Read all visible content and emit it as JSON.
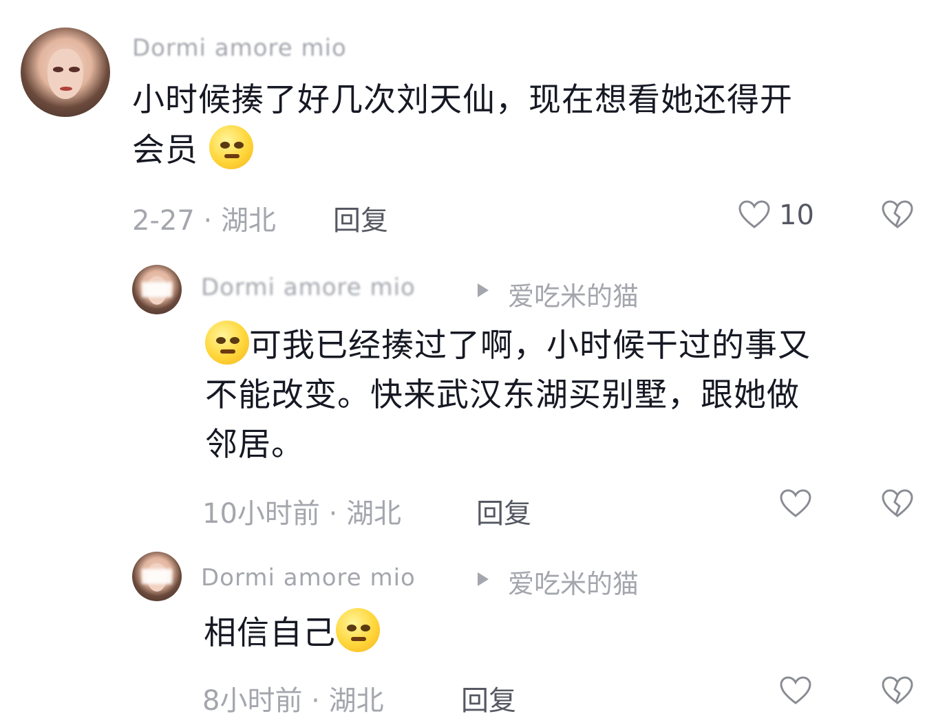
{
  "comments": [
    {
      "username": "Dormi amore mio",
      "text_line1": "小时候揍了好几次刘天仙，现在想看她还得开",
      "text_line2": "会员",
      "emoji": "shy-emoji",
      "date": "2-27",
      "location": "湖北",
      "reply_label": "回复",
      "like_count": "10"
    },
    {
      "username": "Dormi amore mio",
      "reply_to": "爱吃米的猫",
      "text_line1": "可我已经揍过了啊，小时候干过的事又",
      "text_line2": "不能改变。快来武汉东湖买别墅，跟她做",
      "text_line3": "邻居。",
      "emoji": "smirk-emoji",
      "time": "10小时前",
      "location": "湖北",
      "reply_label": "回复"
    },
    {
      "username": "Dormi amore mio",
      "reply_to": "爱吃米的猫",
      "text": "相信自己",
      "emoji": "smirk-emoji",
      "time": "8小时前",
      "location": "湖北",
      "reply_label": "回复"
    }
  ]
}
